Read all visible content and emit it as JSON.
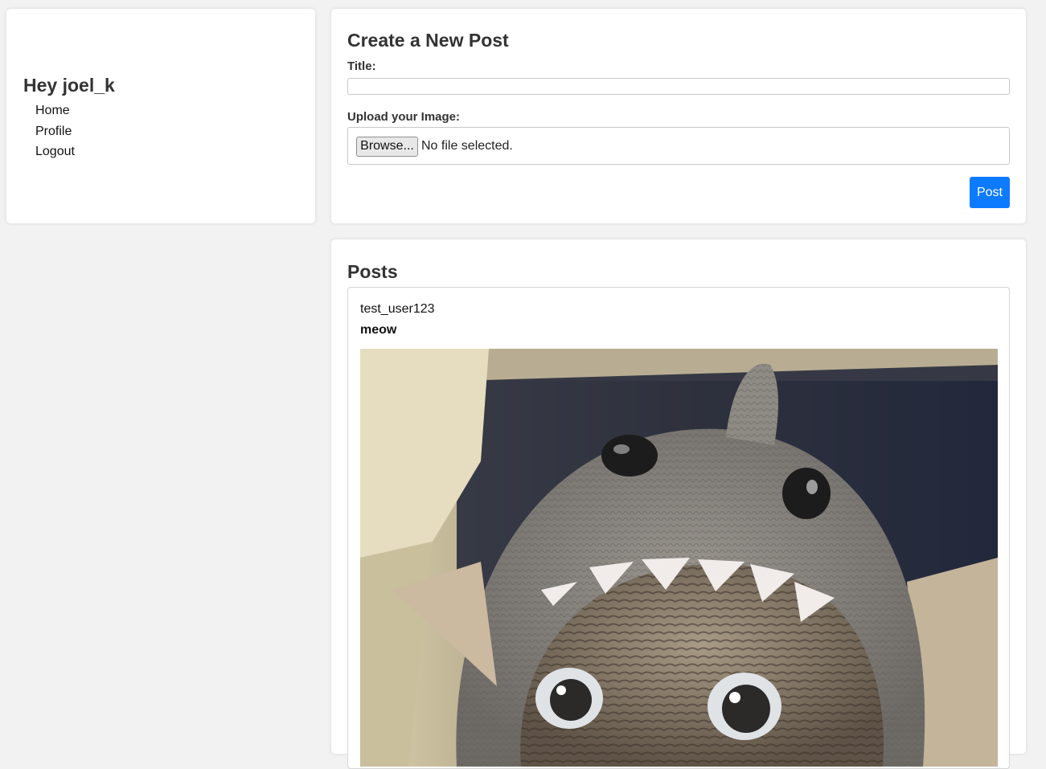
{
  "sidebar": {
    "greeting": "Hey joel_k",
    "nav": [
      {
        "label": "Home"
      },
      {
        "label": "Profile"
      },
      {
        "label": "Logout"
      }
    ]
  },
  "create_post": {
    "heading": "Create a New Post",
    "title_label": "Title:",
    "title_value": "",
    "upload_label": "Upload your Image:",
    "browse_label": "Browse...",
    "file_status": "No file selected.",
    "submit_label": "Post"
  },
  "posts_section": {
    "heading": "Posts",
    "items": [
      {
        "username": "test_user123",
        "title": "meow",
        "image": "cat-in-knitted-shark-hat-photo"
      }
    ]
  },
  "colors": {
    "background": "#f2f2f2",
    "card": "#ffffff",
    "accent": "#0d7bff",
    "heading": "#333333"
  }
}
